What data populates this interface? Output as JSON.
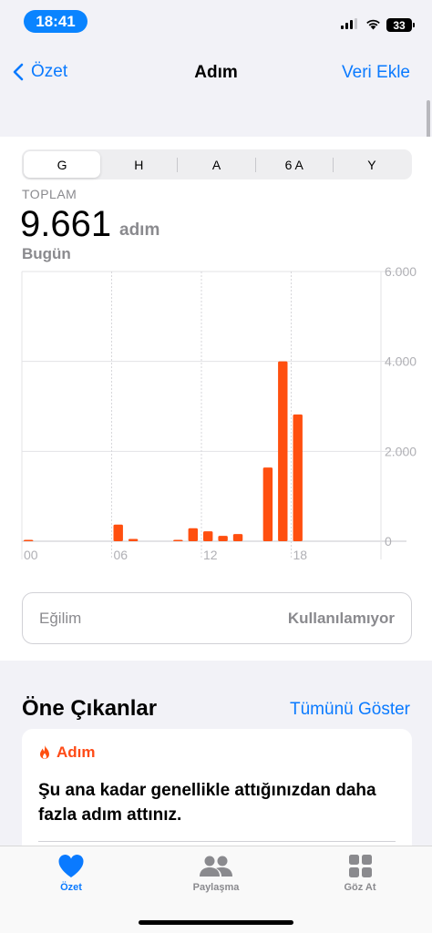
{
  "status": {
    "time": "18:41",
    "battery": "33"
  },
  "nav": {
    "back_label": "Özet",
    "title": "Adım",
    "action_label": "Veri Ekle"
  },
  "segments": [
    "G",
    "H",
    "A",
    "6 A",
    "Y"
  ],
  "summary": {
    "label": "TOPLAM",
    "value": "9.661",
    "unit": "adım",
    "date": "Bugün"
  },
  "chart_data": {
    "type": "bar",
    "x": [
      0,
      6,
      7,
      10,
      11,
      12,
      13,
      14,
      16,
      17,
      18
    ],
    "values": [
      20,
      370,
      50,
      10,
      290,
      220,
      120,
      160,
      1640,
      4000,
      2820
    ],
    "xticks": [
      "00",
      "06",
      "12",
      "18"
    ],
    "yticks": [
      "6.000",
      "4.000",
      "2.000",
      "0"
    ],
    "ylim": [
      0,
      6000
    ],
    "bar_color": "#ff4f0f",
    "grid": true
  },
  "trend": {
    "label": "Eğilim",
    "value": "Kullanılamıyor"
  },
  "highlights": {
    "title": "Öne Çıkanlar",
    "link": "Tümünü Göster",
    "card": {
      "category": "Adım",
      "text": "Şu ana kadar genellikle attığınızdan daha fazla adım attınız."
    }
  },
  "tabs": [
    {
      "label": "Özet",
      "icon": "heart-icon"
    },
    {
      "label": "Paylaşma",
      "icon": "people-icon"
    },
    {
      "label": "Göz At",
      "icon": "grid-icon"
    }
  ],
  "colors": {
    "accent": "#0a7aff",
    "activity": "#ff4f0f",
    "time_pill": "#0a84ff"
  }
}
